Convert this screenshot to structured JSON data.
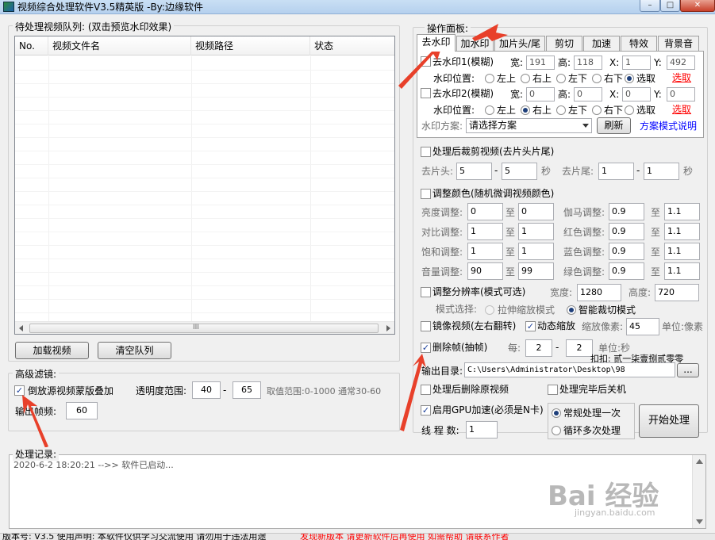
{
  "window": {
    "title": "视频综合处理软件V3.5精英版 -By:边缘软件",
    "min": "–",
    "max": "□",
    "close": "✕"
  },
  "queue": {
    "label": "待处理视频队列: (双击预览水印效果)",
    "columns": [
      "No.",
      "视频文件名",
      "视频路径",
      "状态"
    ],
    "scroll_mid": "III",
    "load_button": "加载视频",
    "clear_button": "清空队列"
  },
  "filter": {
    "label": "高级滤镜:",
    "reverse_overlay": "倒放源视频蒙版叠加",
    "reverse_checked": true,
    "opacity_label": "透明度范围:",
    "opacity_from": "40",
    "dash": "-",
    "opacity_to": "65",
    "range_hint": "取值范围:0-1000 通常30-60",
    "fps_label": "输出帧频:",
    "fps_value": "60"
  },
  "panel": {
    "label": "操作面板:",
    "tabs": [
      "去水印",
      "加水印",
      "加片头/尾",
      "剪切",
      "加速",
      "特效",
      "背景音"
    ],
    "wm1": {
      "label": "去水印1(模糊)",
      "w_label": "宽:",
      "w": "191",
      "h_label": "高:",
      "h": "118",
      "x_label": "X:",
      "x": "1",
      "y_label": "Y:",
      "y": "492",
      "pos_label": "水印位置:",
      "pick": "选取"
    },
    "wm2": {
      "label": "去水印2(模糊)",
      "w_label": "宽:",
      "w": "0",
      "h_label": "高:",
      "h": "0",
      "x_label": "X:",
      "x": "0",
      "y_label": "Y:",
      "y": "0",
      "pos_label": "水印位置:",
      "pick": "选取"
    },
    "positions": [
      "左上",
      "右上",
      "左下",
      "右下",
      "选取"
    ],
    "scheme_label": "水印方案:",
    "scheme_value": "请选择方案",
    "refresh": "刷新",
    "scheme_help": "方案模式说明"
  },
  "trim": {
    "label": "处理后裁剪视频(去片头片尾)",
    "head_label": "去片头:",
    "head_from": "5",
    "head_to": "5",
    "sec": "秒",
    "tail_label": "去片尾:",
    "tail_from": "1",
    "tail_to": "1"
  },
  "color": {
    "label": "调整颜色(随机微调视频颜色)",
    "to": "至",
    "rows_left": [
      {
        "name": "亮度调整:",
        "from": "0",
        "to": "0"
      },
      {
        "name": "对比调整:",
        "from": "1",
        "to": "1"
      },
      {
        "name": "饱和调整:",
        "from": "1",
        "to": "1"
      },
      {
        "name": "音量调整:",
        "from": "90",
        "to": "99"
      }
    ],
    "rows_right": [
      {
        "name": "伽马调整:",
        "from": "0.9",
        "to": "1.1"
      },
      {
        "name": "红色调整:",
        "from": "0.9",
        "to": "1.1"
      },
      {
        "name": "蓝色调整:",
        "from": "0.9",
        "to": "1.1"
      },
      {
        "name": "绿色调整:",
        "from": "0.9",
        "to": "1.1"
      }
    ]
  },
  "resolution": {
    "label": "调整分辨率(模式可选)",
    "w_label": "宽度:",
    "w": "1280",
    "h_label": "高度:",
    "h": "720",
    "mode_label": "模式选择:",
    "mode_stretch": "拉伸缩放模式",
    "mode_crop": "智能裁切模式"
  },
  "mirror": {
    "label": "镜像视频(左右翻转)",
    "zoom_label": "动态缩放",
    "zoom_pixel_label": "缩放像素:",
    "zoom_pixel": "45",
    "unit": "单位:像素"
  },
  "delete_frames": {
    "label": "删除帧(抽帧)",
    "every_label": "每:",
    "every_from": "2",
    "every_to": "2",
    "unit": "单位:秒",
    "note": "扣扣: 贰一柒壹捌贰零零"
  },
  "output": {
    "label": "输出目录:",
    "path": "C:\\Users\\Administrator\\Desktop\\98",
    "browse": "..."
  },
  "options": {
    "delete_source": "处理后删除原视频",
    "shutdown": "处理完毕后关机",
    "gpu": "启用GPU加速(必须是N卡)",
    "threads_label": "线 程 数:",
    "threads": "1",
    "mode_normal": "常规处理一次",
    "mode_loop": "循环多次处理",
    "start": "开始处理"
  },
  "log": {
    "label": "处理记录:",
    "entry": "2020-6-2 18:20:21 -->> 软件已启动..."
  },
  "status": {
    "left": "版本号: V3.5 使用声明: 本软件仅供学习交流使用 请勿用于违法用途",
    "right": "发现新版本 请更新软件后再使用 如需帮助 请联系作者"
  },
  "watermark": {
    "text": "Bai 经验",
    "sub": "jingyan.baidu.com"
  },
  "colors": {
    "link": "#0000ff",
    "red_link": "#ff0000",
    "arrow": "#e8402a",
    "accent": "#1e3f7a"
  }
}
